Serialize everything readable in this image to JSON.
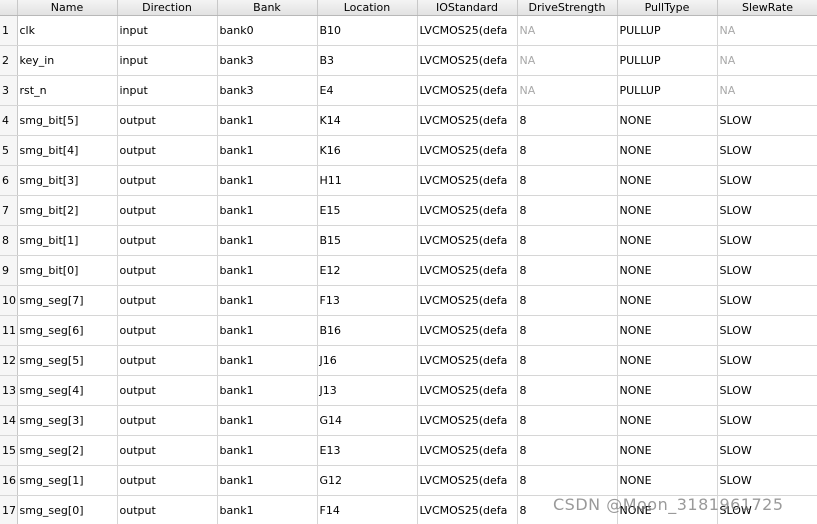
{
  "columns": [
    "Name",
    "Direction",
    "Bank",
    "Location",
    "IOStandard",
    "DriveStrength",
    "PullType",
    "SlewRate"
  ],
  "rows": [
    {
      "num": "1",
      "name": "clk",
      "direction": "input",
      "bank": "bank0",
      "location": "B10",
      "iostandard": "LVCMOS25(defa",
      "drive": "NA",
      "pull": "PULLUP",
      "slew": "NA"
    },
    {
      "num": "2",
      "name": "key_in",
      "direction": "input",
      "bank": "bank3",
      "location": "B3",
      "iostandard": "LVCMOS25(defa",
      "drive": "NA",
      "pull": "PULLUP",
      "slew": "NA"
    },
    {
      "num": "3",
      "name": "rst_n",
      "direction": "input",
      "bank": "bank3",
      "location": "E4",
      "iostandard": "LVCMOS25(defa",
      "drive": "NA",
      "pull": "PULLUP",
      "slew": "NA"
    },
    {
      "num": "4",
      "name": "smg_bit[5]",
      "direction": "output",
      "bank": "bank1",
      "location": "K14",
      "iostandard": "LVCMOS25(defa",
      "drive": "8",
      "pull": "NONE",
      "slew": "SLOW"
    },
    {
      "num": "5",
      "name": "smg_bit[4]",
      "direction": "output",
      "bank": "bank1",
      "location": "K16",
      "iostandard": "LVCMOS25(defa",
      "drive": "8",
      "pull": "NONE",
      "slew": "SLOW"
    },
    {
      "num": "6",
      "name": "smg_bit[3]",
      "direction": "output",
      "bank": "bank1",
      "location": "H11",
      "iostandard": "LVCMOS25(defa",
      "drive": "8",
      "pull": "NONE",
      "slew": "SLOW"
    },
    {
      "num": "7",
      "name": "smg_bit[2]",
      "direction": "output",
      "bank": "bank1",
      "location": "E15",
      "iostandard": "LVCMOS25(defa",
      "drive": "8",
      "pull": "NONE",
      "slew": "SLOW"
    },
    {
      "num": "8",
      "name": "smg_bit[1]",
      "direction": "output",
      "bank": "bank1",
      "location": "B15",
      "iostandard": "LVCMOS25(defa",
      "drive": "8",
      "pull": "NONE",
      "slew": "SLOW"
    },
    {
      "num": "9",
      "name": "smg_bit[0]",
      "direction": "output",
      "bank": "bank1",
      "location": "E12",
      "iostandard": "LVCMOS25(defa",
      "drive": "8",
      "pull": "NONE",
      "slew": "SLOW"
    },
    {
      "num": "10",
      "name": "smg_seg[7]",
      "direction": "output",
      "bank": "bank1",
      "location": "F13",
      "iostandard": "LVCMOS25(defa",
      "drive": "8",
      "pull": "NONE",
      "slew": "SLOW"
    },
    {
      "num": "11",
      "name": "smg_seg[6]",
      "direction": "output",
      "bank": "bank1",
      "location": "B16",
      "iostandard": "LVCMOS25(defa",
      "drive": "8",
      "pull": "NONE",
      "slew": "SLOW"
    },
    {
      "num": "12",
      "name": "smg_seg[5]",
      "direction": "output",
      "bank": "bank1",
      "location": "J16",
      "iostandard": "LVCMOS25(defa",
      "drive": "8",
      "pull": "NONE",
      "slew": "SLOW"
    },
    {
      "num": "13",
      "name": "smg_seg[4]",
      "direction": "output",
      "bank": "bank1",
      "location": "J13",
      "iostandard": "LVCMOS25(defa",
      "drive": "8",
      "pull": "NONE",
      "slew": "SLOW"
    },
    {
      "num": "14",
      "name": "smg_seg[3]",
      "direction": "output",
      "bank": "bank1",
      "location": "G14",
      "iostandard": "LVCMOS25(defa",
      "drive": "8",
      "pull": "NONE",
      "slew": "SLOW"
    },
    {
      "num": "15",
      "name": "smg_seg[2]",
      "direction": "output",
      "bank": "bank1",
      "location": "E13",
      "iostandard": "LVCMOS25(defa",
      "drive": "8",
      "pull": "NONE",
      "slew": "SLOW"
    },
    {
      "num": "16",
      "name": "smg_seg[1]",
      "direction": "output",
      "bank": "bank1",
      "location": "G12",
      "iostandard": "LVCMOS25(defa",
      "drive": "8",
      "pull": "NONE",
      "slew": "SLOW"
    },
    {
      "num": "17",
      "name": "smg_seg[0]",
      "direction": "output",
      "bank": "bank1",
      "location": "F14",
      "iostandard": "LVCMOS25(defa",
      "drive": "8",
      "pull": "NONE",
      "slew": "SLOW"
    }
  ],
  "watermark": "CSDN @Moon_3181961725",
  "colors": {
    "na_text": "#a8a8a8",
    "header_bg": "#ececec",
    "grid_line": "#d6d6d6"
  }
}
